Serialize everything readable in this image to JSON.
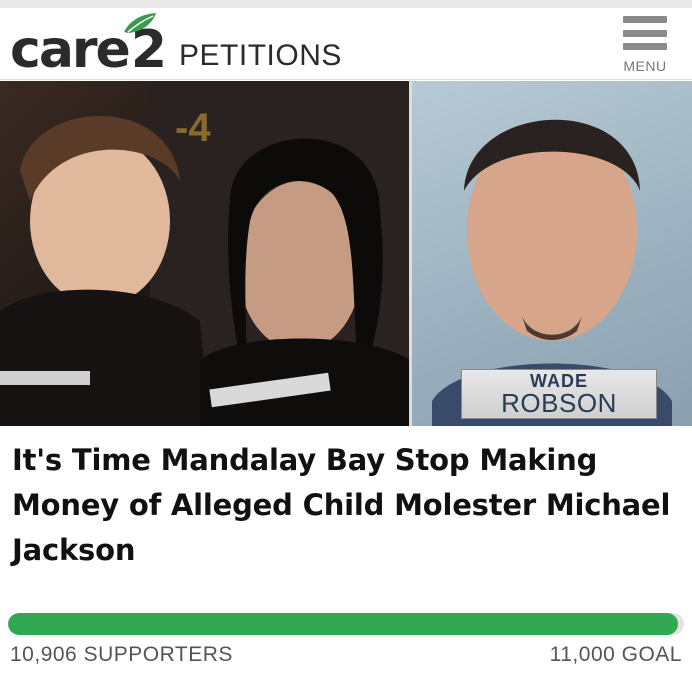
{
  "header": {
    "logo_text": "care",
    "logo_number": "2",
    "logo_subtitle": "PETITIONS",
    "menu_label": "MENU"
  },
  "hero": {
    "caption_first": "WADE",
    "caption_last": "ROBSON"
  },
  "petition": {
    "title": "It's Time Mandalay Bay Stop Making Money of Alleged Child Molester Michael Jackson",
    "supporters_text": "10,906 SUPPORTERS",
    "goal_text": "11,000 GOAL",
    "progress_fraction": 0.9915
  },
  "colors": {
    "accent_green": "#32a852",
    "leaf_green": "#3a9a4e"
  },
  "icons": {
    "menu": "hamburger-icon",
    "logo_leaf": "leaf-icon"
  }
}
